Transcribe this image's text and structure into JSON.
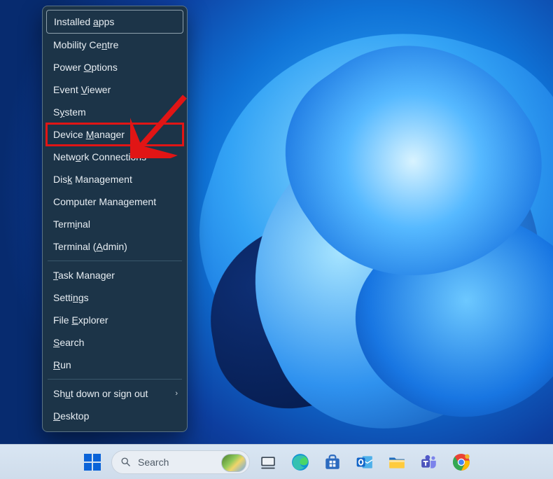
{
  "menu": {
    "groups": [
      [
        {
          "key": "installed-apps",
          "pre": "Installed ",
          "u": "a",
          "post": "pps",
          "top": true
        },
        {
          "key": "mobility-centre",
          "pre": "Mobility Ce",
          "u": "n",
          "post": "tre"
        },
        {
          "key": "power-options",
          "pre": "Power ",
          "u": "O",
          "post": "ptions"
        },
        {
          "key": "event-viewer",
          "pre": "Event ",
          "u": "V",
          "post": "iewer"
        },
        {
          "key": "system",
          "pre": "S",
          "u": "y",
          "post": "stem"
        },
        {
          "key": "device-manager",
          "pre": "Device ",
          "u": "M",
          "post": "anager",
          "highlight": true
        },
        {
          "key": "network-connections",
          "pre": "Netw",
          "u": "o",
          "post": "rk Connections"
        },
        {
          "key": "disk-management",
          "pre": "Dis",
          "u": "k",
          "post": " Management"
        },
        {
          "key": "computer-management",
          "pre": "Computer Mana",
          "u": "g",
          "post": "ement"
        },
        {
          "key": "terminal",
          "pre": "Term",
          "u": "i",
          "post": "nal"
        },
        {
          "key": "terminal-admin",
          "pre": "Terminal (",
          "u": "A",
          "post": "dmin)"
        }
      ],
      [
        {
          "key": "task-manager",
          "pre": "",
          "u": "T",
          "post": "ask Manager"
        },
        {
          "key": "settings",
          "pre": "Setti",
          "u": "n",
          "post": "gs"
        },
        {
          "key": "file-explorer",
          "pre": "File ",
          "u": "E",
          "post": "xplorer"
        },
        {
          "key": "search",
          "pre": "",
          "u": "S",
          "post": "earch"
        },
        {
          "key": "run",
          "pre": "",
          "u": "R",
          "post": "un"
        }
      ],
      [
        {
          "key": "shut-down",
          "pre": "Sh",
          "u": "u",
          "post": "t down or sign out",
          "submenu": true
        },
        {
          "key": "desktop",
          "pre": "",
          "u": "D",
          "post": "esktop"
        }
      ]
    ]
  },
  "search": {
    "placeholder": "Search"
  },
  "taskbar_icons": [
    {
      "key": "start",
      "name": "start-button"
    },
    {
      "key": "search",
      "name": "search-pill"
    },
    {
      "key": "task-view",
      "name": "task-view-icon"
    },
    {
      "key": "edge",
      "name": "edge-icon"
    },
    {
      "key": "store",
      "name": "microsoft-store-icon"
    },
    {
      "key": "outlook",
      "name": "outlook-icon"
    },
    {
      "key": "file-explorer",
      "name": "file-explorer-icon"
    },
    {
      "key": "teams",
      "name": "teams-icon"
    },
    {
      "key": "chrome",
      "name": "chrome-icon"
    }
  ],
  "annotation": {
    "target": "device-manager",
    "color": "#e11515"
  }
}
